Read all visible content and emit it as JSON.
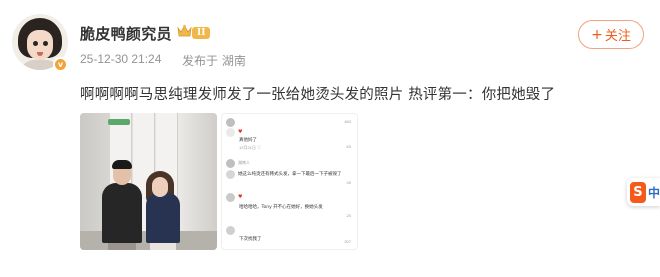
{
  "user": {
    "name": "脆皮鸭颜究员",
    "level": "II",
    "verified_mark": "v"
  },
  "meta": {
    "time": "25-12-30 21:24",
    "location": "发布于 湖南"
  },
  "follow_button": {
    "icon": "+",
    "label": "关注"
  },
  "post": {
    "text": "啊啊啊啊马思纯理发师发了一张给她烫头发的照片 热评第一：你把她毁了"
  },
  "comments_image": {
    "comments": [
      {
        "text": "",
        "meta": "",
        "likes": "463"
      },
      {
        "text": "真他妈了",
        "meta": "12月21日 ♡",
        "likes": "63"
      },
      {
        "text": "湖南人",
        "meta": "",
        "likes": ""
      },
      {
        "text": "她这么纯烫还有韩式头发，拿一下最后一下子被毁了",
        "meta": "",
        "likes": "40"
      },
      {
        "text": "哈哈哈哈，Tony 开不心在她好，换她头发",
        "meta": "",
        "likes": "20"
      },
      {
        "text": "下次找我了",
        "meta": "",
        "likes": "207"
      }
    ]
  },
  "float_widget": {
    "icon_letter": "S",
    "label": "中"
  },
  "colors": {
    "accent": "#f05b1b",
    "follow_border": "#f3a37b",
    "meta_gray": "#939393",
    "level_badge": "#f0b84a"
  }
}
